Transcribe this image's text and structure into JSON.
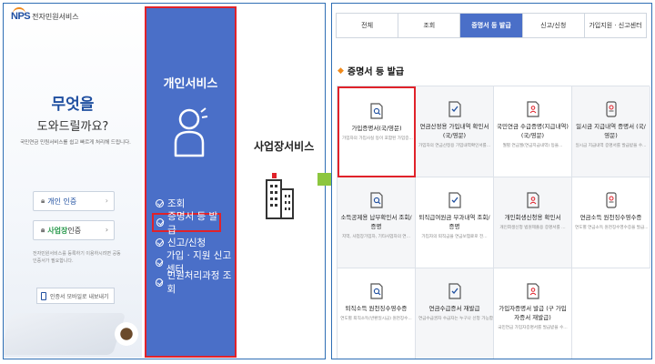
{
  "left_panel": {
    "logo_mark": "NPS",
    "logo_text": "전자민원서비스",
    "hero_line1": "무엇을",
    "hero_line2": "도와드릴까요?",
    "hero_sub": "국민연금 민원서비스를 쉽고 빠르게 처리해 드립니다.",
    "cert_individual": "개인 인증",
    "cert_business_strong": "사업장",
    "cert_business_rest": " 인증",
    "cert_note": "전자민원서비스를 등록하기 이용하시려면 공동인증서가 필요합니다.",
    "mobile_button": "인증서 모바일로 내보내기",
    "personal_service_title": "개인서비스",
    "personal_menu": [
      "조회",
      "증명서 등 발급",
      "신고/신청",
      "가입 · 지원 신고센터",
      "민원처리과정 조회"
    ],
    "business_service_title": "사업장서비스"
  },
  "right_panel": {
    "tabs": [
      {
        "label": "전체",
        "active": false
      },
      {
        "label": "조회",
        "active": false
      },
      {
        "label": "증명서 등 발급",
        "active": true
      },
      {
        "label": "신고/신청",
        "active": false
      },
      {
        "label": "가입지원 · 신고센터",
        "active": false
      }
    ],
    "section_title": "증명서 등 발급",
    "cards": [
      {
        "title": "가입증명서(국/영문)",
        "desc": "가입자의 가입사실 등이 포함된 가입증...",
        "icon": "document-search-icon",
        "highlight": true
      },
      {
        "title": "연금산정용 가입내역 확인서 (국/영문)",
        "desc": "가입자의 연금산정용 가입내역확인서를...",
        "icon": "document-check-icon",
        "highlight": false
      },
      {
        "title": "국민연금 수급증명(지급내역) (국/영문)",
        "desc": "월별 연금월(연금지급내역) 등을...",
        "icon": "document-person-icon",
        "highlight": false
      },
      {
        "title": "일시금 지급내역 증명서 (국/영문)",
        "desc": "일시금 지급내역 증명서를 발급받을 수...",
        "icon": "phone-doc-icon",
        "highlight": false
      },
      {
        "title": "소득공제용 납부확인서 조회/증명",
        "desc": "지역, 사업장가입자, 기타사업자의 연...",
        "icon": "document-search-icon",
        "highlight": false
      },
      {
        "title": "퇴직급여원금 부과내역 조회/증명",
        "desc": "가입자의 퇴직금을 연금보험료로 전...",
        "icon": "document-check-icon",
        "highlight": false
      },
      {
        "title": "개인회생신청용 확인서",
        "desc": "개인회생신청 법원제출용 증명서를 ...",
        "icon": "document-person-icon",
        "highlight": false
      },
      {
        "title": "연금소득 원천징수영수증",
        "desc": "연도별 연금소득 원천징수영수증을 발급...",
        "icon": "phone-doc-icon",
        "highlight": false
      },
      {
        "title": "퇴직소득 원천징수영수증",
        "desc": "연도별 퇴직소득(반환일시금) 원천징수...",
        "icon": "document-search-icon",
        "highlight": false
      },
      {
        "title": "연금수급증서 재발급",
        "desc": "연금수급권자 수급자는 누구나 신청 가능합...",
        "icon": "document-check-icon",
        "highlight": false
      },
      {
        "title": "가입자증명서 발급 (구 가입자증서 재발급)",
        "desc": "국민연금 가입자증명서를 발급받을 수...",
        "icon": "document-person-icon",
        "highlight": false
      }
    ]
  },
  "colors": {
    "accent_blue": "#4a6fc8",
    "highlight_red": "#e0222a",
    "arrow_green": "#8cc63f",
    "border_blue": "#2f6fb5"
  }
}
